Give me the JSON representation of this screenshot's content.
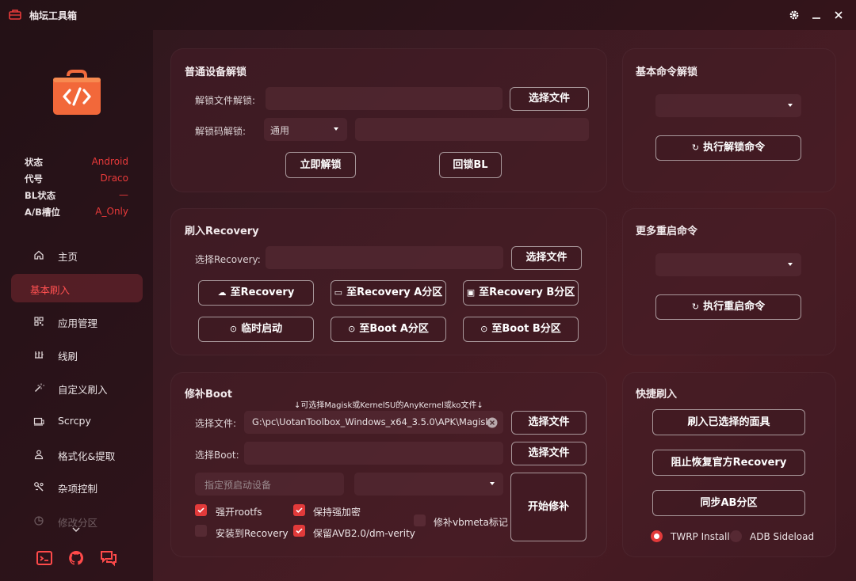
{
  "app": {
    "title": "柚坛工具箱"
  },
  "device_status": [
    {
      "label": "状态",
      "value": "Android"
    },
    {
      "label": "代号",
      "value": "Draco"
    },
    {
      "label": "BL状态",
      "value": "—"
    },
    {
      "label": "A/B槽位",
      "value": "A_Only"
    }
  ],
  "nav": [
    {
      "label": "主页",
      "icon": "home-icon"
    },
    {
      "label": "基本刷入",
      "icon": "",
      "active": true
    },
    {
      "label": "应用管理",
      "icon": "apps-icon"
    },
    {
      "label": "线刷",
      "icon": "flash-icon"
    },
    {
      "label": "自定义刷入",
      "icon": "wand-icon"
    },
    {
      "label": "Scrcpy",
      "icon": "screen-icon"
    },
    {
      "label": "格式化&提取",
      "icon": "user-icon"
    },
    {
      "label": "杂项控制",
      "icon": "tools-icon"
    },
    {
      "label": "修改分区",
      "icon": "pie-icon"
    }
  ],
  "unlock": {
    "title": "普通设备解锁",
    "file_label": "解锁文件解锁:",
    "file_value": "",
    "choose_file": "选择文件",
    "code_label": "解锁码解锁:",
    "code_mode": "通用",
    "code_value": "",
    "unlock_now": "立即解锁",
    "relock": "回锁BL"
  },
  "basic_cmd": {
    "title": "基本命令解锁",
    "selected": "",
    "exec": "执行解锁命令"
  },
  "recovery": {
    "title": "刷入Recovery",
    "label": "选择Recovery:",
    "value": "",
    "choose_file": "选择文件",
    "buttons": [
      {
        "label": "至Recovery",
        "icon": "cloud-icon"
      },
      {
        "label": "至Recovery A分区",
        "icon": "monitor-icon"
      },
      {
        "label": "至Recovery B分区",
        "icon": "display-icon"
      },
      {
        "label": "临时启动",
        "icon": "boot-icon"
      },
      {
        "label": "至Boot A分区",
        "icon": "boot-icon"
      },
      {
        "label": "至Boot B分区",
        "icon": "boot-icon"
      }
    ]
  },
  "reboot_cmd": {
    "title": "更多重启命令",
    "selected": "",
    "exec": "执行重启命令"
  },
  "patch": {
    "title": "修补Boot",
    "hint": "↓可选择Magisk或KernelSU的AnyKernel或ko文件↓",
    "file_label": "选择文件:",
    "file_value": "G:\\pc\\UotanToolbox_Windows_x64_3.5.0\\APK\\Magisk",
    "choose_file": "选择文件",
    "boot_label": "选择Boot:",
    "boot_value": "",
    "choose_boot": "选择文件",
    "preset_placeholder": "指定预启动设备",
    "start": "开始修补",
    "options": [
      {
        "label": "强开rootfs",
        "checked": true
      },
      {
        "label": "保持强加密",
        "checked": true
      },
      {
        "label": "修补vbmeta标记",
        "checked": false
      },
      {
        "label": "安装到Recovery",
        "checked": false
      },
      {
        "label": "保留AVB2.0/dm-verity",
        "checked": true
      }
    ]
  },
  "quick": {
    "title": "快捷刷入",
    "buttons": [
      "刷入已选择的面具",
      "阻止恢复官方Recovery",
      "同步AB分区"
    ],
    "radio": [
      {
        "label": "TWRP Install",
        "selected": true
      },
      {
        "label": "ADB Sideload",
        "selected": false
      }
    ]
  },
  "colors": {
    "accent": "#e23a3a",
    "status_value": "#e83a3a",
    "logo": "#f26a3c"
  }
}
